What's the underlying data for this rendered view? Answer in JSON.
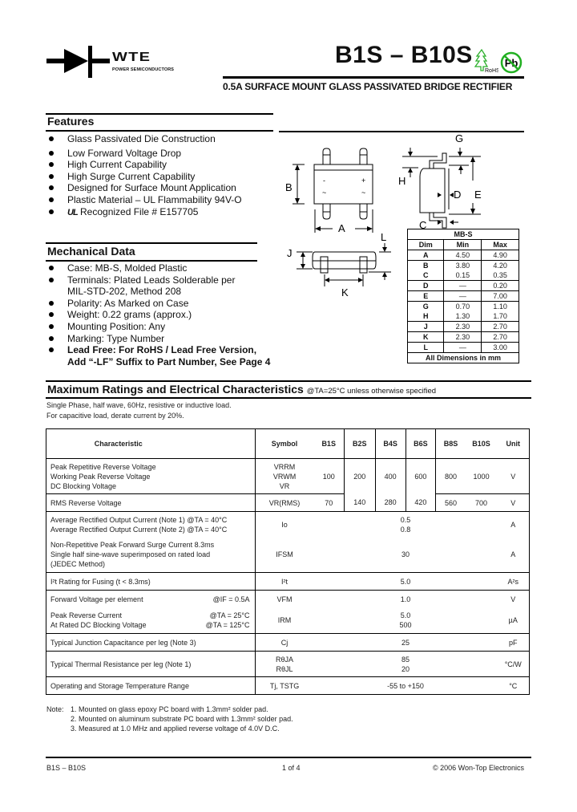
{
  "header": {
    "brand": "WTE",
    "brand_tagline": "POWER SEMICONDUCTORS",
    "title": "B1S – B10S",
    "rohs_label": "RoHS",
    "pb_label": "Pb",
    "subtitle": "0.5A SURFACE MOUNT GLASS PASSIVATED BRIDGE RECTIFIER",
    "colors": {
      "rohs_green": "#2db02d",
      "pb_green": "#22b022"
    }
  },
  "features": {
    "title": "Features",
    "items": [
      "Glass Passivated Die Construction",
      "Low Forward Voltage Drop",
      "High Current Capability",
      "High Surge Current Capability",
      "Designed for Surface Mount Application",
      "Plastic Material – UL Flammability 94V-O",
      "Recognized File # E157705"
    ],
    "ul_mark": "UL"
  },
  "mechanical": {
    "title": "Mechanical Data",
    "items": [
      "Case: MB-S, Molded Plastic",
      "Terminals: Plated Leads Solderable per",
      "MIL-STD-202, Method 208",
      "Polarity: As Marked on Case",
      "Weight: 0.22 grams (approx.)",
      "Mounting Position: Any",
      "Marking: Type Number",
      "Lead Free: For RoHS / Lead Free Version,",
      "Add “-LF” Suffix to Part Number, See Page 4"
    ]
  },
  "diagram": {
    "labels": {
      "A": "A",
      "B": "B",
      "C": "C",
      "D": "D",
      "E": "E",
      "G": "G",
      "H": "H",
      "J": "J",
      "K": "K",
      "L": "L"
    },
    "pin_minus": "-",
    "pin_plus": "+",
    "pin_ac1": "~",
    "pin_ac2": "~"
  },
  "dims_table": {
    "package": "MB-S",
    "headers": [
      "Dim",
      "Min",
      "Max"
    ],
    "rows": [
      [
        "A",
        "4.50",
        "4.90"
      ],
      [
        "B",
        "3.80",
        "4.20"
      ],
      [
        "C",
        "0.15",
        "0.35"
      ],
      [
        "D",
        "—",
        "0.20"
      ],
      [
        "E",
        "—",
        "7.00"
      ],
      [
        "G",
        "0.70",
        "1.10"
      ],
      [
        "H",
        "1.30",
        "1.70"
      ],
      [
        "J",
        "2.30",
        "2.70"
      ],
      [
        "K",
        "2.30",
        "2.70"
      ],
      [
        "L",
        "—",
        "3.00"
      ]
    ],
    "footer": "All Dimensions in mm"
  },
  "ratings": {
    "title": "Maximum Ratings and Electrical Characteristics",
    "condition": "@TA=25°C unless otherwise specified",
    "note1": "Single Phase, half wave, 60Hz, resistive or inductive load.",
    "note2": "For capacitive load, derate current by 20%.",
    "headers": [
      "Characteristic",
      "Symbol",
      "B1S",
      "B2S",
      "B4S",
      "B6S",
      "B8S",
      "B10S",
      "Unit"
    ],
    "r1": {
      "lines": [
        "Peak Repetitive Reverse Voltage",
        "Working Peak Reverse Voltage",
        "DC Blocking Voltage"
      ],
      "symbols": [
        "VRRM",
        "VRWM",
        "VR"
      ],
      "values": [
        "100",
        "200",
        "400",
        "600",
        "800",
        "1000"
      ],
      "unit": "V"
    },
    "r2": {
      "label": "RMS Reverse Voltage",
      "symbol": "VR(RMS)",
      "values": [
        "70",
        "140",
        "280",
        "420",
        "560",
        "700"
      ],
      "unit": "V"
    },
    "r3": {
      "lines": [
        "Average Rectified Output Current (Note 1) @TA = 40°C",
        "Average Rectified Output Current (Note 2) @TA = 40°C"
      ],
      "symbol": "Io",
      "values": [
        "0.5",
        "0.8"
      ],
      "unit": "A"
    },
    "r4": {
      "lines": [
        "Non-Repetitive Peak Forward Surge Current 8.3ms",
        "Single half sine-wave superimposed on rated load",
        "(JEDEC Method)"
      ],
      "symbol": "IFSM",
      "value": "30",
      "unit": "A"
    },
    "r5": {
      "label": "I²t Rating for Fusing (t < 8.3ms)",
      "symbol": "I²t",
      "value": "5.0",
      "unit": "A²s"
    },
    "r6": {
      "label": "Forward Voltage per element",
      "cond": "@IF = 0.5A",
      "symbol": "VFM",
      "value": "1.0",
      "unit": "V"
    },
    "r7": {
      "lines": [
        "Peak Reverse Current",
        "At Rated DC Blocking Voltage"
      ],
      "conds": [
        "@TA = 25°C",
        "@TA = 125°C"
      ],
      "symbol": "IRM",
      "values": [
        "5.0",
        "500"
      ],
      "unit": "µA"
    },
    "r8": {
      "label": "Typical Junction Capacitance per leg (Note 3)",
      "symbol": "Cj",
      "value": "25",
      "unit": "pF"
    },
    "r9": {
      "label": "Typical Thermal Resistance per leg (Note 1)",
      "symbols": [
        "RθJA",
        "RθJL"
      ],
      "values": [
        "85",
        "20"
      ],
      "unit": "°C/W"
    },
    "r10": {
      "label": "Operating and Storage Temperature Range",
      "symbol": "Tj, TSTG",
      "value": "-55 to +150",
      "unit": "°C"
    }
  },
  "notes": {
    "prefix": "Note:",
    "items": [
      "1. Mounted on glass epoxy PC board with 1.3mm² solder pad.",
      "2. Mounted on aluminum substrate PC board with 1.3mm² solder pad.",
      "3. Measured at 1.0 MHz and applied reverse voltage of 4.0V D.C."
    ]
  },
  "footer": {
    "left": "B1S – B10S",
    "center": "1 of 4",
    "right": "© 2006 Won-Top Electronics"
  }
}
